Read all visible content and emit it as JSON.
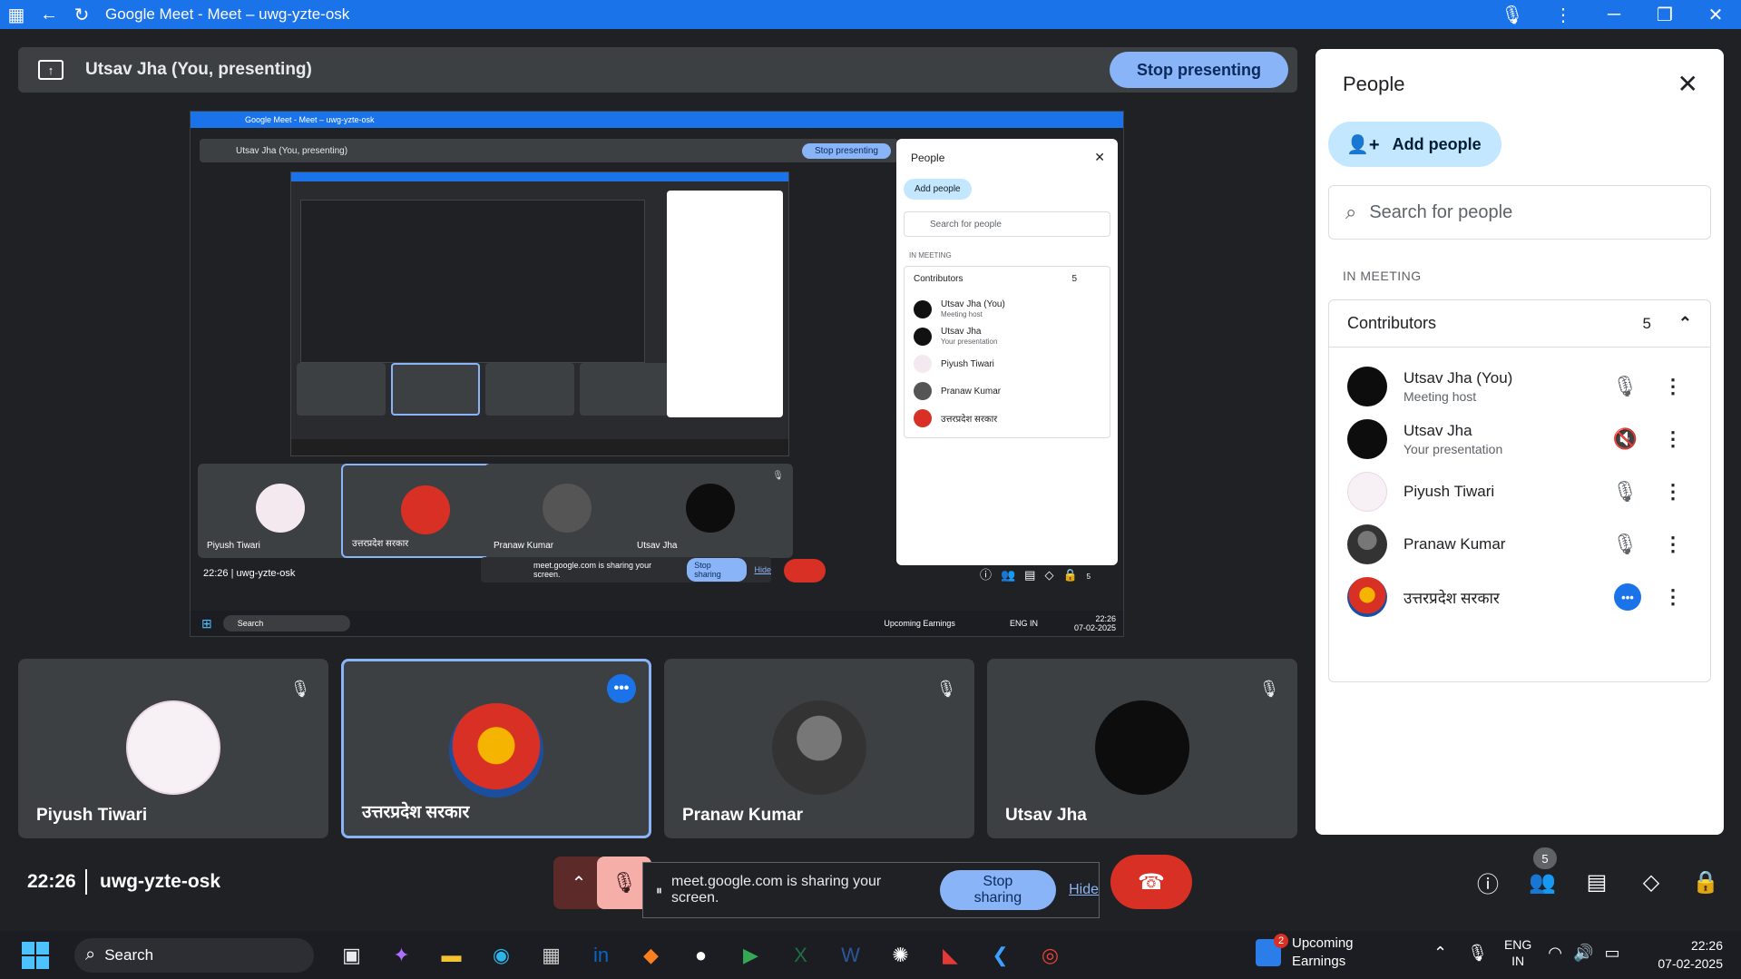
{
  "window": {
    "title": "Google Meet - Meet – uwg-yzte-osk",
    "accent": "#1a73e8"
  },
  "presenting": {
    "label": "Utsav Jha (You, presenting)",
    "stop_label": "Stop presenting"
  },
  "shared_screen": {
    "title": "Google Meet - Meet – uwg-yzte-osk",
    "presenting_label": "Utsav Jha (You, presenting)",
    "stop_label": "Stop presenting",
    "tiles": [
      "Piyush Tiwari",
      "उत्तरप्रदेश सरकार",
      "Pranaw Kumar",
      "Utsav Jha"
    ],
    "footer_time": "22:26",
    "footer_code": "uwg-yzte-osk",
    "sharing_text": "meet.google.com is sharing your screen.",
    "stop_sharing": "Stop sharing",
    "hide": "Hide",
    "people_badge": "5",
    "taskbar_search": "Search",
    "weather": "Upcoming Earnings",
    "lang": "ENG IN",
    "time": "22:26",
    "date": "07-02-2025",
    "panel": {
      "title": "People",
      "add_people": "Add people",
      "search_placeholder": "Search for people",
      "in_meeting": "IN MEETING",
      "contributors": "Contributors",
      "count": "5",
      "rows": [
        {
          "name": "Utsav Jha (You)",
          "sub": "Meeting host"
        },
        {
          "name": "Utsav Jha",
          "sub": "Your presentation"
        },
        {
          "name": "Piyush Tiwari",
          "sub": ""
        },
        {
          "name": "Pranaw Kumar",
          "sub": ""
        },
        {
          "name": "उत्तरप्रदेश सरकार",
          "sub": ""
        }
      ]
    }
  },
  "tiles": [
    {
      "name": "Piyush Tiwari",
      "avatar": "piyush-avatar",
      "mic": "muted"
    },
    {
      "name": "उत्तरप्रदेश सरकार",
      "avatar": "up-govt-emblem",
      "mic": "more"
    },
    {
      "name": "Pranaw Kumar",
      "avatar": "pranaw-avatar",
      "mic": "muted"
    },
    {
      "name": "Utsav Jha",
      "avatar": "utsav-avatar",
      "mic": "muted"
    }
  ],
  "meeting": {
    "time": "22:26",
    "code": "uwg-yzte-osk"
  },
  "controls": {
    "sharing_text": "meet.google.com is sharing your screen.",
    "stop_sharing": "Stop sharing",
    "hide": "Hide",
    "people_badge": "5",
    "end_color": "#d93025"
  },
  "panel": {
    "title": "People",
    "add_people": "Add people",
    "search_placeholder": "Search for people",
    "in_meeting": "IN MEETING",
    "contributors": "Contributors",
    "count": "5",
    "rows": [
      {
        "name": "Utsav Jha (You)",
        "sub": "Meeting host",
        "mic": "muted"
      },
      {
        "name": "Utsav Jha",
        "sub": "Your presentation",
        "mic": "audio-off"
      },
      {
        "name": "Piyush Tiwari",
        "sub": "",
        "mic": "muted"
      },
      {
        "name": "Pranaw Kumar",
        "sub": "",
        "mic": "muted"
      },
      {
        "name": "उत्तरप्रदेश सरकार",
        "sub": "",
        "mic": "more"
      }
    ]
  },
  "taskbar": {
    "search": "Search",
    "weather_badge": "2",
    "weather_line1": "Upcoming",
    "weather_line2": "Earnings",
    "lang_line1": "ENG",
    "lang_line2": "IN",
    "time": "22:26",
    "date": "07-02-2025"
  }
}
